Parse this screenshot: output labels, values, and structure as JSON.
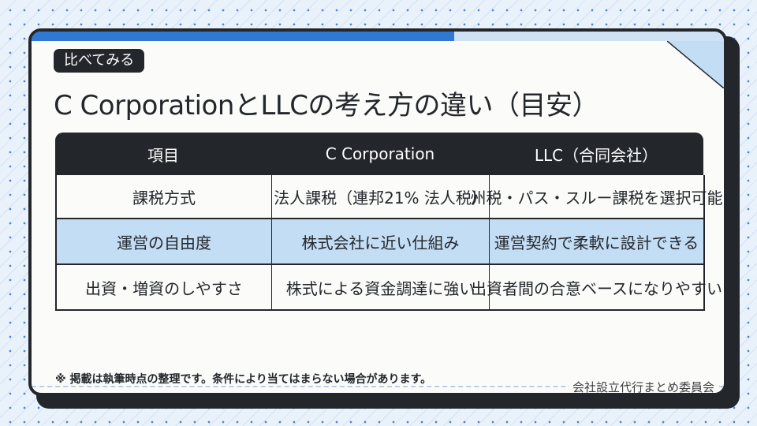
{
  "badge": "比べてみる",
  "title": "C CorporationとLLCの考え方の違い（目安）",
  "progress": 0.61,
  "colors": {
    "dark": "#23262b",
    "accent": "#2f78d3",
    "highlight": "#c3ddf4",
    "paper": "#fbfcfa"
  },
  "table": {
    "headers": [
      "項目",
      "C Corporation",
      "LLC（合同会社）"
    ],
    "rows": [
      [
        "課税方式",
        "法人課税（連邦21% 法人税）",
        "州税・パス・スルー課税を選択可能"
      ],
      [
        "運営の自由度",
        "株式会社に近い仕組み",
        "運営契約で柔軟に設計できる"
      ],
      [
        "出資・増資のしやすさ",
        "株式による資金調達に強い",
        "出資者間の合意ベースになりやすい"
      ]
    ]
  },
  "footnote": "※ 掲載は執筆時点の整理です。条件により当てはまらない場合があります。",
  "organization": "会社設立代行まとめ委員会"
}
